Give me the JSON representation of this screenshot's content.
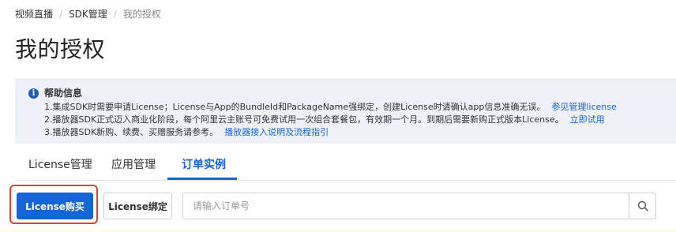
{
  "breadcrumb": {
    "items": [
      "视频直播",
      "SDK管理",
      "我的授权"
    ],
    "separator": "/"
  },
  "page": {
    "title": "我的授权"
  },
  "help": {
    "icon": "info-icon",
    "title": "帮助信息",
    "lines": [
      {
        "text": "1.集成SDK时需要申请License；License与App的BundleId和PackageName强绑定，创建License时请确认app信息准确无误。",
        "link": "参见管理license"
      },
      {
        "text": "2.播放器SDK正式迈入商业化阶段，每个阿里云主账号可免费试用一次组合套餐包，有效期一个月。到期后需要新购正式版本License。",
        "link": "立即试用"
      },
      {
        "text": "3.播放器SDK新购、续费、买赠服务请参考。",
        "link": "播放器接入说明及流程指引"
      }
    ]
  },
  "tabs": [
    {
      "label": "License管理",
      "active": false
    },
    {
      "label": "应用管理",
      "active": false
    },
    {
      "label": "订单实例",
      "active": true
    }
  ],
  "toolbar": {
    "buy_label": "License购买",
    "bind_label": "License绑定",
    "search_placeholder": "请输入订单号",
    "search_value": ""
  },
  "colors": {
    "accent": "#1565d8",
    "highlight": "#e2432b",
    "help_bg": "#eef2f8"
  }
}
